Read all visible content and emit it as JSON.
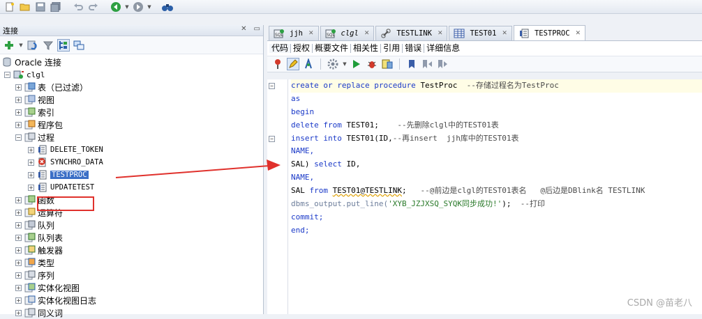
{
  "main_toolbar": {
    "icons": [
      "new-icon",
      "open-folder-icon",
      "save-icon",
      "save-all-icon",
      "undo-icon",
      "redo-icon",
      "back-icon",
      "forward-icon",
      "binoculars-icon"
    ]
  },
  "left_panel": {
    "title": "连接",
    "root": "Oracle 连接",
    "connection": "clgl",
    "categories_before": [
      "表（已过滤）",
      "视图",
      "索引",
      "程序包",
      "过程"
    ],
    "procedures": [
      "DELETE_TOKEN",
      "SYNCHRO_DATA",
      "TESTPROC",
      "UPDATETEST"
    ],
    "selected_procedure": "TESTPROC",
    "categories_after": [
      "函数",
      "运算符",
      "队列",
      "队列表",
      "触发器",
      "类型",
      "序列",
      "实体化视图",
      "实体化视图日志",
      "同义词"
    ]
  },
  "editor": {
    "doc_tabs": [
      {
        "label": "jjh",
        "icon": "sql-worksheet-icon"
      },
      {
        "label": "clgl",
        "icon": "sql-worksheet-icon"
      },
      {
        "label": "TESTLINK",
        "icon": "link-icon"
      },
      {
        "label": "TEST01",
        "icon": "table-icon"
      },
      {
        "label": "TESTPROC",
        "icon": "procedure-icon"
      }
    ],
    "active_tab": "TESTPROC",
    "sub_tabs": [
      "代码",
      "授权",
      "概要文件",
      "相关性",
      "引用",
      "错误",
      "详细信息"
    ],
    "active_sub_tab": "代码",
    "code_lines": [
      "create or replace procedure TestProc  --存储过程名为TestProc",
      "as",
      "begin",
      "delete from TEST01;    --先删除clgl中的TEST01表",
      "insert into TEST01(ID,--再insert  jjh库中的TEST01表",
      "NAME,",
      "SAL) select ID,",
      "NAME,",
      "SAL from TEST01@TESTLINK;   --@前边是clgl的TEST01表名   @后边是DBlink名 TESTLINK",
      "dbms_output.put_line('XYB_JZJXSQ_SYQK同步成功!');  --打印",
      "commit;",
      "end;"
    ]
  },
  "watermark": "CSDN @苗老八",
  "colors": {
    "keyword": "#1a39c8",
    "selection": "#3b6fc6",
    "annotation_red": "#e0312c"
  }
}
